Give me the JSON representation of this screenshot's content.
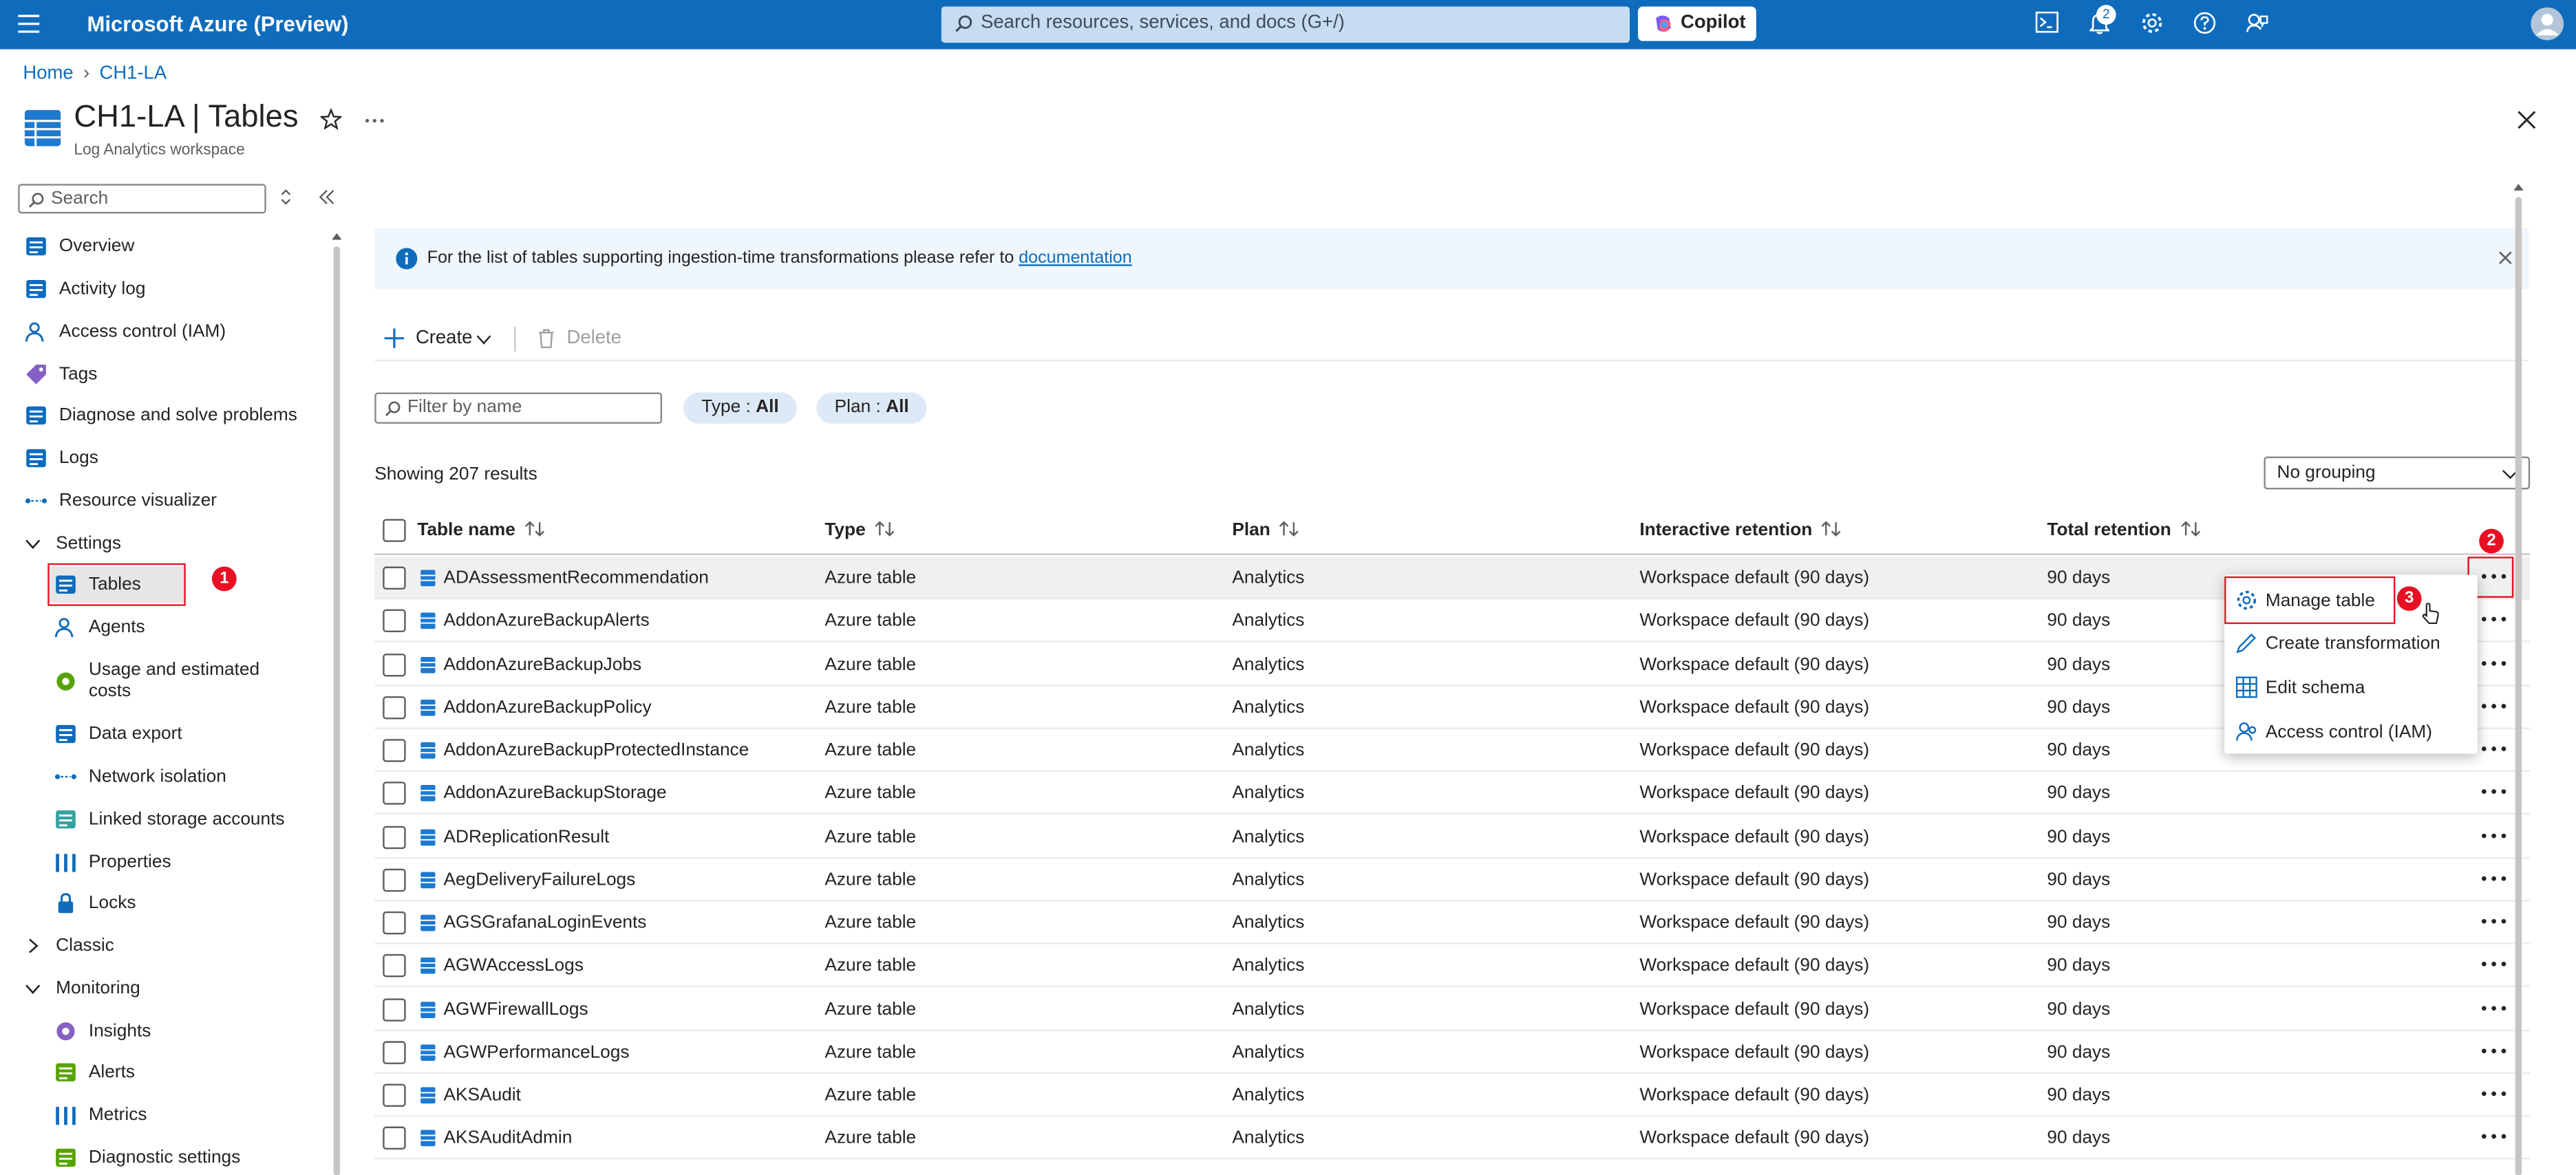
{
  "topbar": {
    "brand": "Microsoft Azure (Preview)",
    "search_placeholder": "Search resources, services, and docs (G+/)",
    "copilot": "Copilot",
    "notif_count": "2"
  },
  "breadcrumb": {
    "home": "Home",
    "current": "CH1-LA"
  },
  "page": {
    "title": "CH1-LA | Tables",
    "subtitle": "Log Analytics workspace"
  },
  "sidebar": {
    "search_placeholder": "Search",
    "items": [
      {
        "label": "Overview",
        "icon": "overview-icon"
      },
      {
        "label": "Activity log",
        "icon": "activity-log-icon"
      },
      {
        "label": "Access control (IAM)",
        "icon": "iam-icon"
      },
      {
        "label": "Tags",
        "icon": "tag-icon"
      },
      {
        "label": "Diagnose and solve problems",
        "icon": "wrench-icon"
      },
      {
        "label": "Logs",
        "icon": "logs-icon"
      },
      {
        "label": "Resource visualizer",
        "icon": "visualizer-icon"
      },
      {
        "label": "Settings",
        "icon": "chevron-down-icon"
      },
      {
        "label": "Tables",
        "icon": "table-icon"
      },
      {
        "label": "Agents",
        "icon": "agents-icon"
      },
      {
        "label": "Usage and estimated costs",
        "icon": "usage-icon"
      },
      {
        "label": "Data export",
        "icon": "export-icon"
      },
      {
        "label": "Network isolation",
        "icon": "network-icon"
      },
      {
        "label": "Linked storage accounts",
        "icon": "storage-icon"
      },
      {
        "label": "Properties",
        "icon": "properties-icon"
      },
      {
        "label": "Locks",
        "icon": "lock-icon"
      },
      {
        "label": "Classic",
        "icon": "chevron-right-icon"
      },
      {
        "label": "Monitoring",
        "icon": "chevron-down-icon"
      },
      {
        "label": "Insights",
        "icon": "insights-icon"
      },
      {
        "label": "Alerts",
        "icon": "alerts-icon"
      },
      {
        "label": "Metrics",
        "icon": "metrics-icon"
      },
      {
        "label": "Diagnostic settings",
        "icon": "diagnostic-icon"
      }
    ]
  },
  "info": {
    "text": "For the list of tables supporting ingestion-time transformations please refer to ",
    "link": "documentation"
  },
  "toolbar": {
    "create": "Create",
    "delete": "Delete"
  },
  "filters": {
    "name_placeholder": "Filter by name",
    "type_label": "Type : ",
    "type_value": "All",
    "plan_label": "Plan : ",
    "plan_value": "All"
  },
  "showing": "Showing 207 results",
  "grouping": "No grouping",
  "table": {
    "headers": [
      "Table name",
      "Type",
      "Plan",
      "Interactive retention",
      "Total retention"
    ],
    "rows": [
      [
        "ADAssessmentRecommendation",
        "Azure table",
        "Analytics",
        "Workspace default (90 days)",
        "90 days"
      ],
      [
        "AddonAzureBackupAlerts",
        "Azure table",
        "Analytics",
        "Workspace default (90 days)",
        "90 days"
      ],
      [
        "AddonAzureBackupJobs",
        "Azure table",
        "Analytics",
        "Workspace default (90 days)",
        "90 days"
      ],
      [
        "AddonAzureBackupPolicy",
        "Azure table",
        "Analytics",
        "Workspace default (90 days)",
        "90 days"
      ],
      [
        "AddonAzureBackupProtectedInstance",
        "Azure table",
        "Analytics",
        "Workspace default (90 days)",
        "90 days"
      ],
      [
        "AddonAzureBackupStorage",
        "Azure table",
        "Analytics",
        "Workspace default (90 days)",
        "90 days"
      ],
      [
        "ADReplicationResult",
        "Azure table",
        "Analytics",
        "Workspace default (90 days)",
        "90 days"
      ],
      [
        "AegDeliveryFailureLogs",
        "Azure table",
        "Analytics",
        "Workspace default (90 days)",
        "90 days"
      ],
      [
        "AGSGrafanaLoginEvents",
        "Azure table",
        "Analytics",
        "Workspace default (90 days)",
        "90 days"
      ],
      [
        "AGWAccessLogs",
        "Azure table",
        "Analytics",
        "Workspace default (90 days)",
        "90 days"
      ],
      [
        "AGWFirewallLogs",
        "Azure table",
        "Analytics",
        "Workspace default (90 days)",
        "90 days"
      ],
      [
        "AGWPerformanceLogs",
        "Azure table",
        "Analytics",
        "Workspace default (90 days)",
        "90 days"
      ],
      [
        "AKSAudit",
        "Azure table",
        "Analytics",
        "Workspace default (90 days)",
        "90 days"
      ],
      [
        "AKSAuditAdmin",
        "Azure table",
        "Analytics",
        "Workspace default (90 days)",
        "90 days"
      ]
    ]
  },
  "context_menu": [
    "Manage table",
    "Create transformation",
    "Edit schema",
    "Access control (IAM)"
  ],
  "steps": [
    "1",
    "2",
    "3"
  ],
  "colors": {
    "accent": "#0f6cbd",
    "highlight": "#e81123"
  }
}
